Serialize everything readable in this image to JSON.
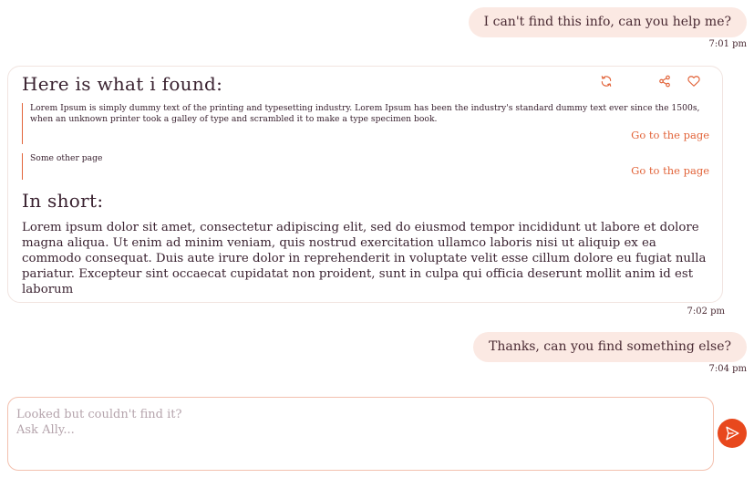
{
  "conversation": {
    "messages": [
      {
        "role": "user",
        "text": "I can't find this info, can you help me?",
        "time": "7:01 pm"
      },
      {
        "role": "assistant",
        "time": "7:02 pm"
      },
      {
        "role": "user",
        "text": "Thanks, can you find something else?",
        "time": "7:04 pm"
      }
    ]
  },
  "answer": {
    "found_heading": "Here is what i found:",
    "sources": [
      {
        "text": "Lorem Ipsum is simply dummy text of the printing and typesetting industry. Lorem Ipsum has been the industry's standard dummy text ever since the 1500s, when an unknown printer took a galley of type and scrambled it to make a type specimen book.",
        "link": "Go to the page"
      },
      {
        "text": "Some other page",
        "link": "Go to the page"
      }
    ],
    "short_heading": "In short:",
    "short_text": "Lorem ipsum dolor sit amet, consectetur adipiscing elit, sed do eiusmod tempor incididunt ut labore et dolore magna aliqua. Ut enim ad minim veniam, quis nostrud exercitation ullamco laboris nisi ut aliquip ex ea commodo consequat. Duis aute irure dolor in reprehenderit in voluptate velit esse cillum dolore eu fugiat nulla pariatur. Excepteur sint occaecat cupidatat non proident, sunt in culpa qui officia deserunt mollit anim id est laborum",
    "tools": [
      "refresh-icon",
      "share-icon",
      "heart-icon"
    ]
  },
  "composer": {
    "placeholder": "Looked but couldn't find it?\nAsk Ally..."
  },
  "colors": {
    "accent": "#e8481d",
    "link": "#e2643a",
    "user_bubble": "#fbe9e3",
    "text": "#3a2230"
  }
}
